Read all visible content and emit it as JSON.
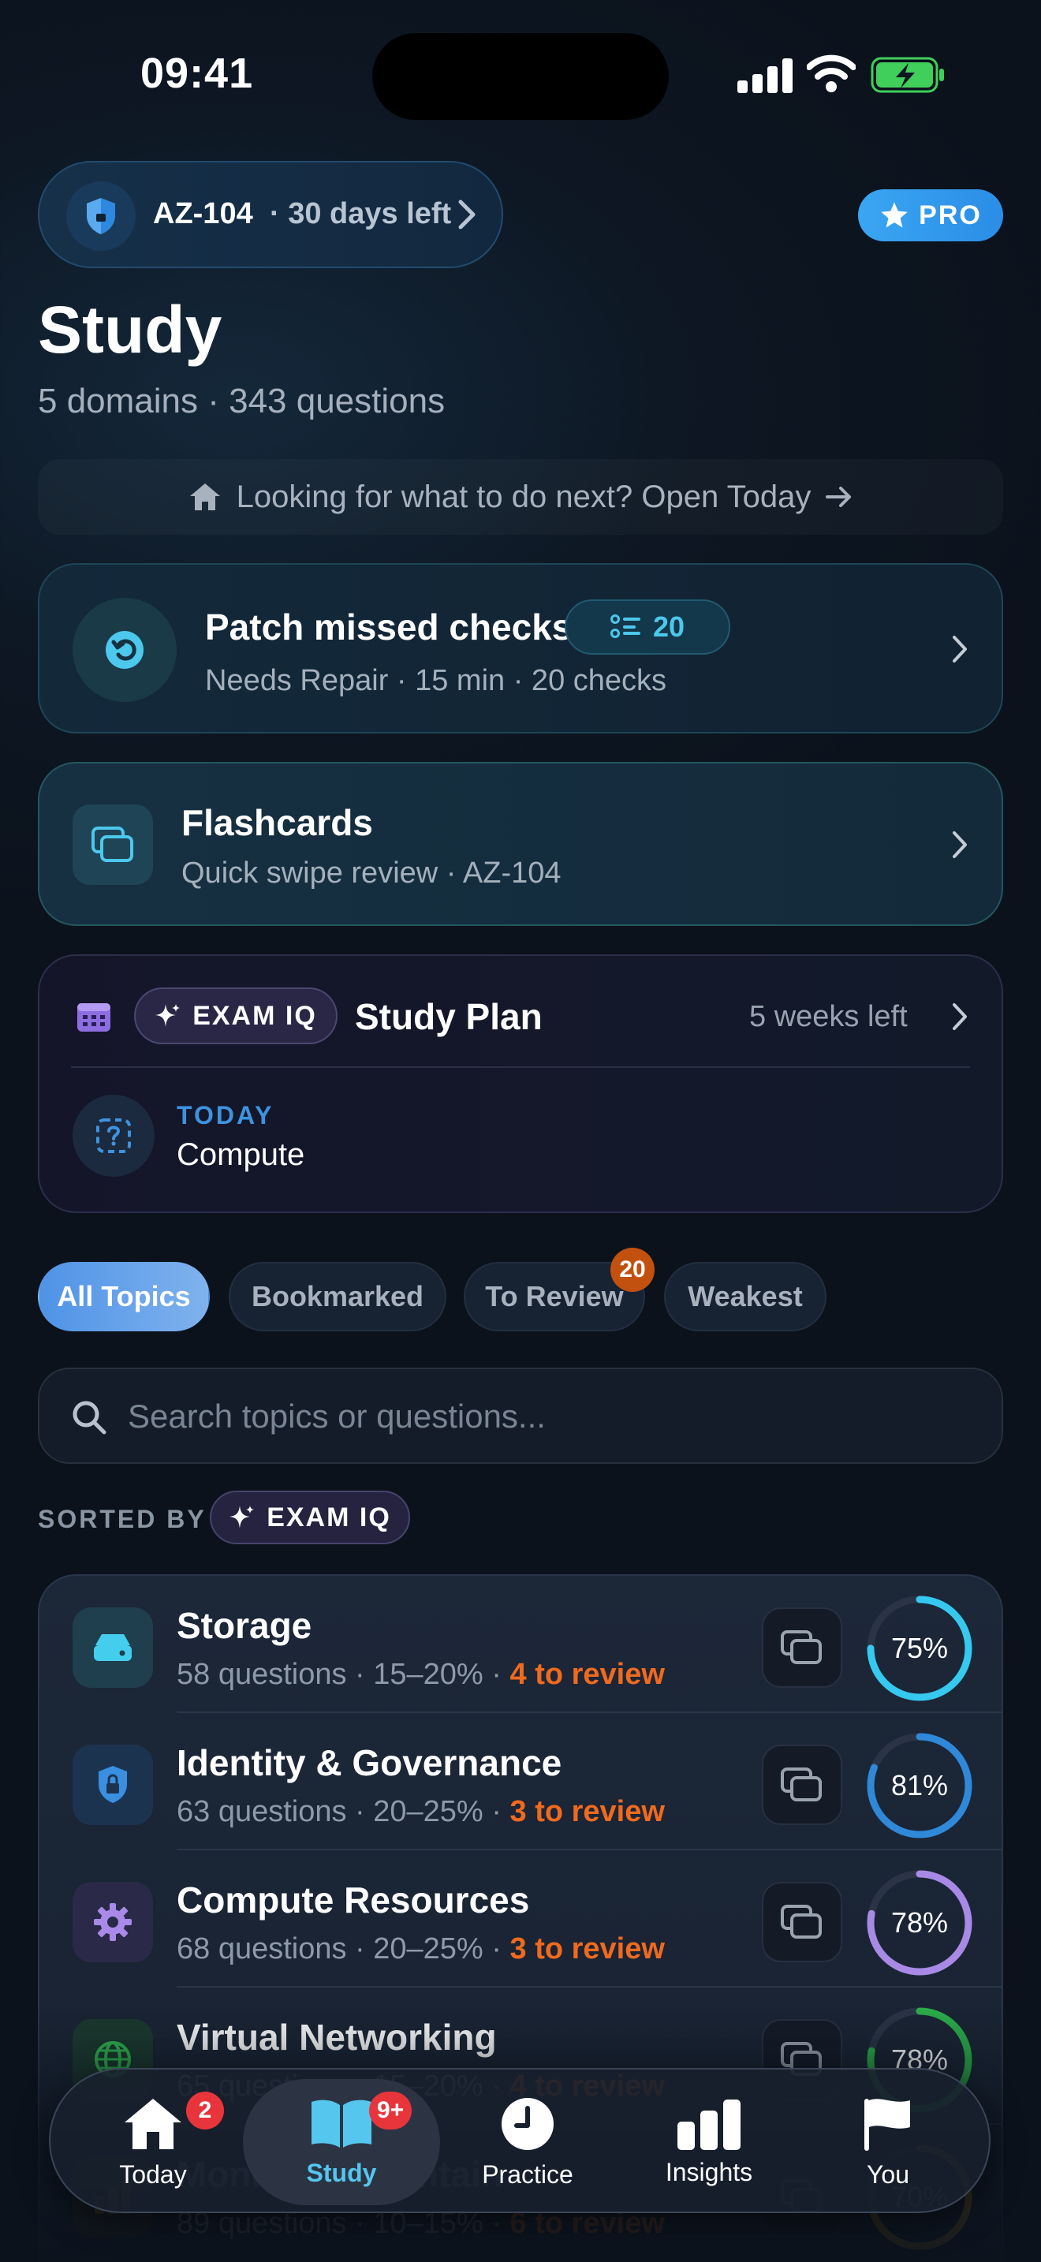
{
  "status_bar": {
    "time": "09:41"
  },
  "exam": {
    "code": "AZ-104",
    "days_left": "· 30 days left"
  },
  "pro_badge": {
    "label": "PRO"
  },
  "header": {
    "title": "Study",
    "subtitle": "5 domains · 343 questions"
  },
  "hint": {
    "text": "Looking for what to do next? Open Today"
  },
  "patch_card": {
    "title": "Patch missed checks",
    "badge_count": "20",
    "subtitle": "Needs Repair · 15 min · 20 checks"
  },
  "flashcards_card": {
    "title": "Flashcards",
    "subtitle": "Quick swipe review · AZ-104"
  },
  "study_plan": {
    "exam_iq_label": "EXAM IQ",
    "title": "Study Plan",
    "weeks_left": "5 weeks left",
    "today_label": "TODAY",
    "today_task": "Compute"
  },
  "filters": {
    "chips": [
      {
        "label": "All Topics",
        "active": true
      },
      {
        "label": "Bookmarked",
        "active": false
      },
      {
        "label": "To Review",
        "active": false,
        "count": "20"
      },
      {
        "label": "Weakest",
        "active": false
      }
    ]
  },
  "search": {
    "placeholder": "Search topics or questions..."
  },
  "sort": {
    "label": "SORTED BY",
    "value": "EXAM IQ"
  },
  "topics": [
    {
      "name": "Storage",
      "questions": "58 questions · 15–20% ·",
      "review": "4 to review",
      "percent": 75,
      "percent_label": "75%",
      "ring_color": "#36c9ef",
      "icon": "storage-drive-icon",
      "icon_bg": "#1f3e4e",
      "icon_color": "#45cdee"
    },
    {
      "name": "Identity & Governance",
      "questions": "63 questions · 20–25% ·",
      "review": "3 to review",
      "percent": 81,
      "percent_label": "81%",
      "ring_color": "#2f88d8",
      "icon": "shield-lock-icon",
      "icon_bg": "#1c3350",
      "icon_color": "#3a8fe0"
    },
    {
      "name": "Compute Resources",
      "questions": "68 questions · 20–25% ·",
      "review": "3 to review",
      "percent": 78,
      "percent_label": "78%",
      "ring_color": "#a88ae6",
      "icon": "gear-icon",
      "icon_bg": "#2a2a48",
      "icon_color": "#a98ae8"
    },
    {
      "name": "Virtual Networking",
      "questions": "65 questions · 15–20% ·",
      "review": "4 to review",
      "percent": 78,
      "percent_label": "78%",
      "ring_color": "#2bb04a",
      "icon": "globe-icon",
      "icon_bg": "#1b3a2e",
      "icon_color": "#2fb84e"
    },
    {
      "name": "Monitor & Maintain",
      "questions": "89 questions · 10–15% ·",
      "review": "6 to review",
      "percent": 70,
      "percent_label": "70%",
      "ring_color": "#c79a2a",
      "icon": "chart-icon",
      "icon_bg": "#3a3220",
      "icon_color": "#c79a2a"
    }
  ],
  "tabbar": {
    "tabs": [
      {
        "label": "Today",
        "icon": "home-icon",
        "badge": "2"
      },
      {
        "label": "Study",
        "icon": "book-icon",
        "badge": "9+",
        "active": true
      },
      {
        "label": "Practice",
        "icon": "clock-icon"
      },
      {
        "label": "Insights",
        "icon": "bar-chart-icon"
      },
      {
        "label": "You",
        "icon": "flag-icon"
      }
    ]
  },
  "colors": {
    "accent": "#4cc8ec",
    "review_orange": "#f06a1e",
    "badge_red": "#e8353c",
    "pro_blue": "#3aa6f2"
  }
}
